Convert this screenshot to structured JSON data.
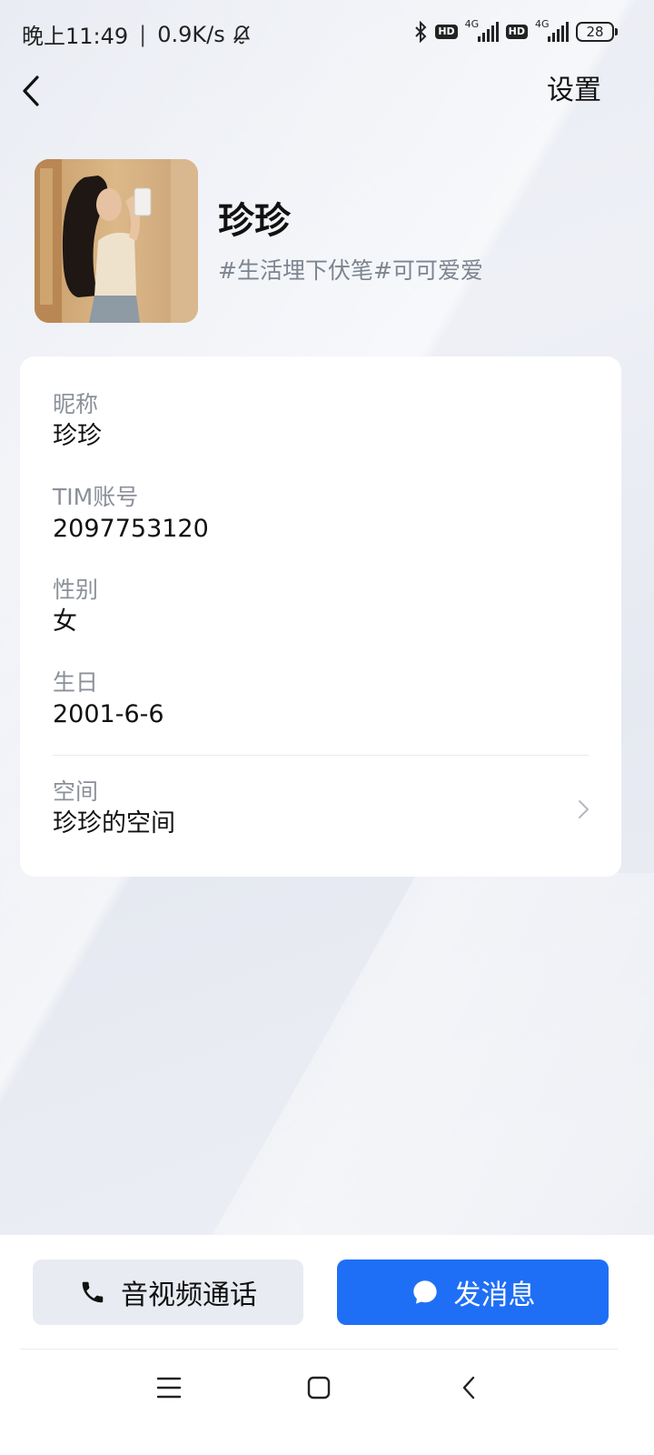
{
  "status_bar": {
    "time": "晚上11:49",
    "separator": "|",
    "net_speed": "0.9K/s",
    "network_1": "4G",
    "network_2": "4G",
    "hd_badge": "HD",
    "battery": "28",
    "icons": [
      "bell-mute-icon",
      "bluetooth-icon",
      "hd-icon",
      "signal-icon",
      "battery-icon"
    ]
  },
  "header": {
    "back_icon": "chevron-left-icon",
    "settings_label": "设置"
  },
  "profile": {
    "name": "珍珍",
    "signature": "#生活埋下伏笔#可可爱爱"
  },
  "info": {
    "nickname": {
      "label": "昵称",
      "value": "珍珍"
    },
    "tim_account": {
      "label": "TIM账号",
      "value": "2097753120"
    },
    "gender": {
      "label": "性别",
      "value": "女"
    },
    "birthday": {
      "label": "生日",
      "value": "2001-6-6"
    },
    "space": {
      "label": "空间",
      "value": "珍珍的空间"
    }
  },
  "actions": {
    "call_label": "音视频通话",
    "message_label": "发消息"
  },
  "colors": {
    "primary": "#1f6ff6",
    "secondary_button": "#e8ebf1",
    "label_gray": "#8b9099"
  }
}
